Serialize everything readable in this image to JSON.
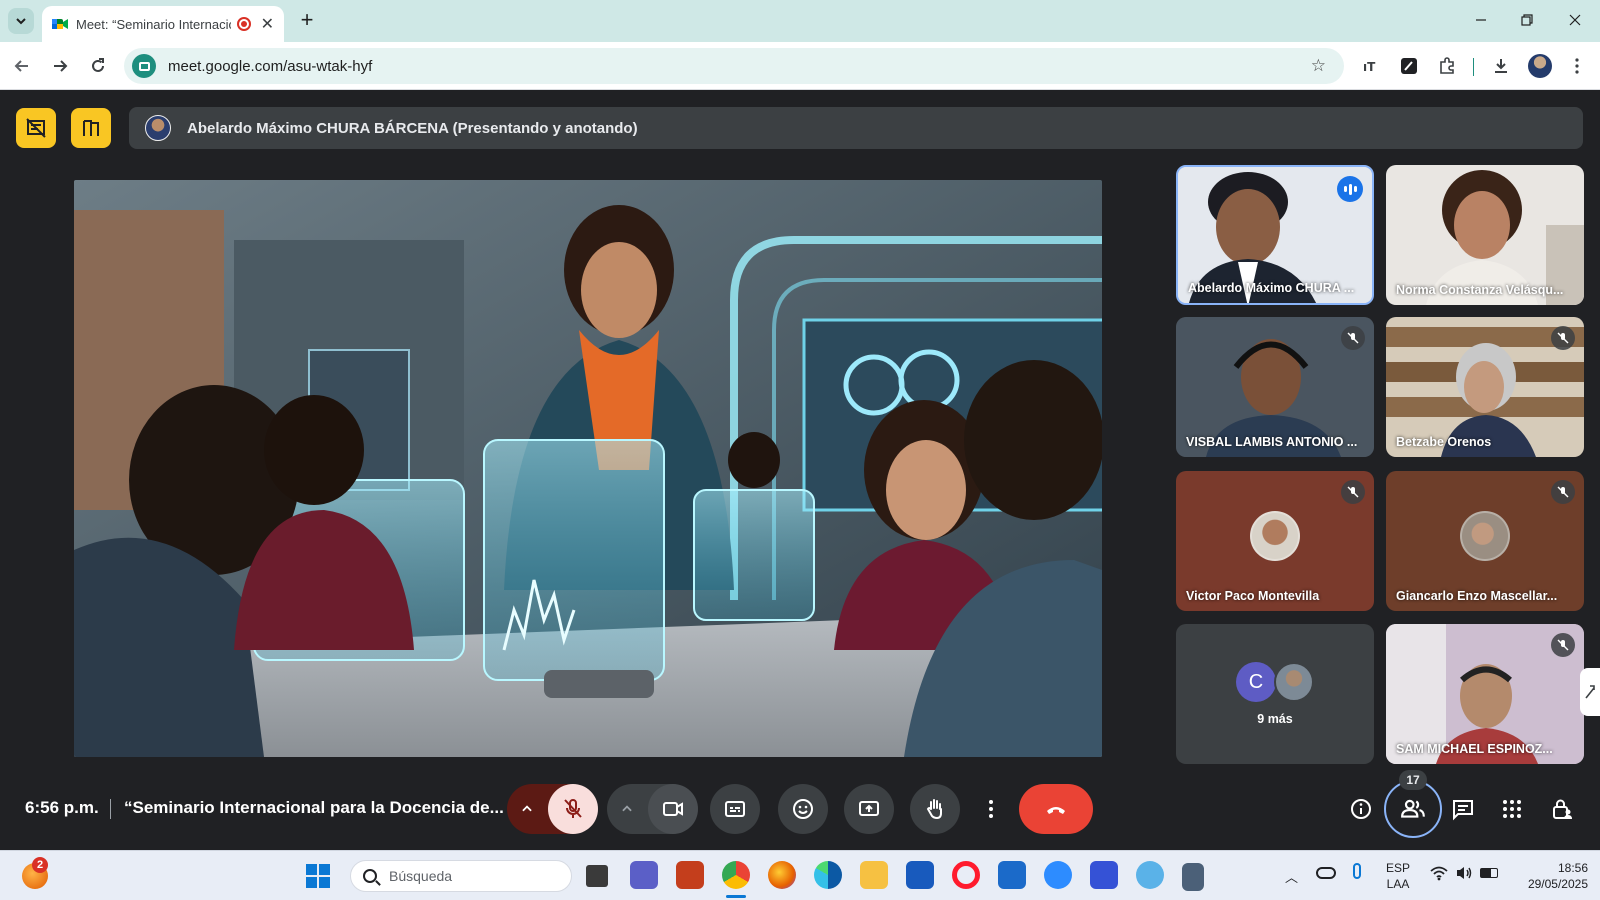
{
  "browser": {
    "tab_title": "Meet: “Seminario Internacio",
    "url": "meet.google.com/asu-wtak-hyf"
  },
  "meet": {
    "presenter_label": "Abelardo Máximo CHURA BÁRCENA (Presentando y anotando)",
    "participants": [
      {
        "name": "Abelardo Máximo CHURA ...",
        "state": "speaking"
      },
      {
        "name": "Norma Constanza Velásqu...",
        "state": "none"
      },
      {
        "name": "VISBAL LAMBIS ANTONIO ...",
        "state": "muted"
      },
      {
        "name": "Betzabe Orenos",
        "state": "muted"
      },
      {
        "name": "Victor Paco Montevilla",
        "state": "muted"
      },
      {
        "name": "Giancarlo Enzo Mascellar...",
        "state": "muted"
      },
      {
        "name": "9 más",
        "state": "none",
        "initial": "C"
      },
      {
        "name": "SAM MICHAEL ESPINOZ...",
        "state": "muted"
      }
    ],
    "time": "6:56 p.m.",
    "meeting_title": "“Seminario Internacional para la Docencia de...",
    "people_count": "17",
    "colors": {
      "accent_yellow": "#f9c623",
      "end_call": "#ea4335",
      "mic_off_bg": "#f9dedc",
      "bar_bg": "#202124"
    }
  },
  "taskbar": {
    "notification_count": "2",
    "search_placeholder": "Búsqueda",
    "lang_top": "ESP",
    "lang_bottom": "LAA",
    "clock_time": "18:56",
    "clock_date": "29/05/2025"
  }
}
